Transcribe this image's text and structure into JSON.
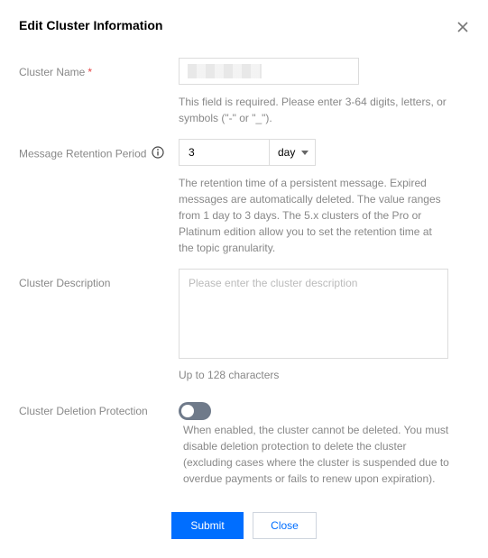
{
  "dialog": {
    "title": "Edit Cluster Information"
  },
  "cluster_name": {
    "label": "Cluster Name",
    "required_mark": "*",
    "help": "This field is required. Please enter 3-64 digits, letters, or symbols (\"-\" or \"_\")."
  },
  "retention": {
    "label": "Message Retention Period",
    "value": "3",
    "unit": "day",
    "help": "The retention time of a persistent message. Expired messages are automatically deleted. The value ranges from 1 day to 3 days. The 5.x clusters of the Pro or Platinum edition allow you to set the retention time at the topic granularity."
  },
  "description": {
    "label": "Cluster Description",
    "placeholder": "Please enter the cluster description",
    "limit": "Up to 128 characters"
  },
  "deletion_protection": {
    "label": "Cluster Deletion Protection",
    "enabled": false,
    "help": "When enabled, the cluster cannot be deleted. You must disable deletion protection to delete the cluster (excluding cases where the cluster is suspended due to overdue payments or fails to renew upon expiration)."
  },
  "footer": {
    "submit_label": "Submit",
    "close_label": "Close"
  },
  "colors": {
    "primary": "#006eff",
    "required": "#e54545",
    "toggle_off": "#6f7a8a"
  }
}
